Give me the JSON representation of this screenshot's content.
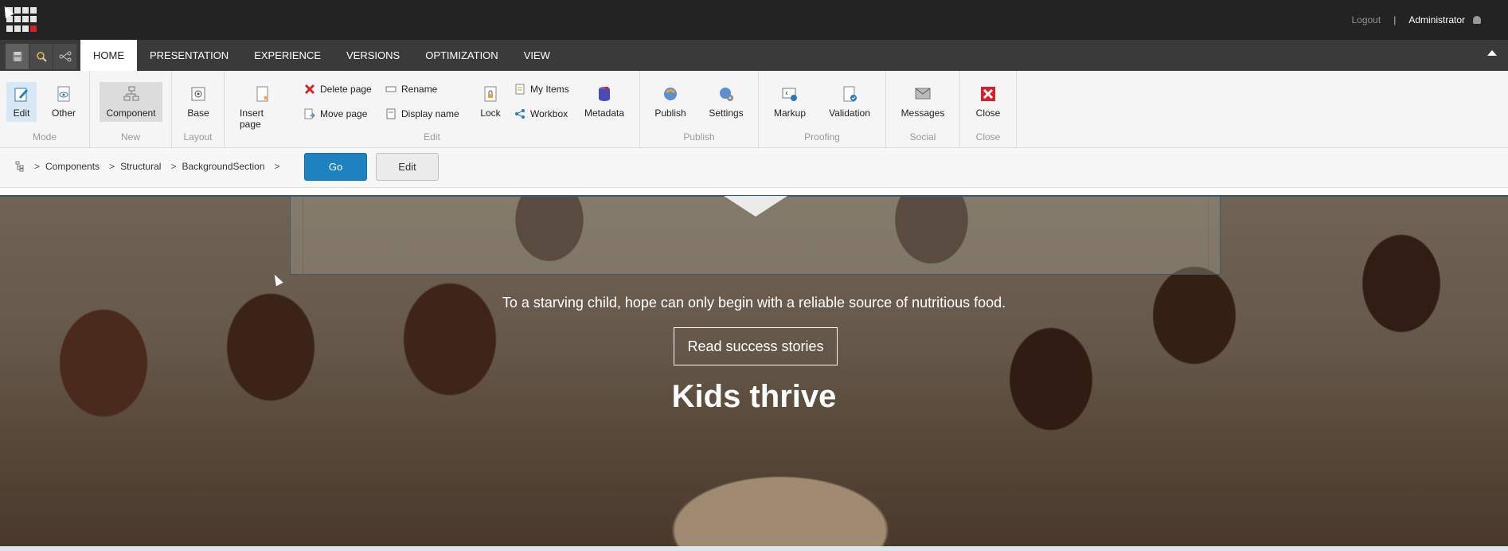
{
  "topbar": {
    "logout": "Logout",
    "separator": "|",
    "user": "Administrator"
  },
  "quick_access": [
    "save-icon",
    "search-icon",
    "navigate-icon"
  ],
  "tabs": [
    {
      "label": "HOME",
      "active": true
    },
    {
      "label": "PRESENTATION"
    },
    {
      "label": "EXPERIENCE"
    },
    {
      "label": "VERSIONS"
    },
    {
      "label": "OPTIMIZATION"
    },
    {
      "label": "VIEW"
    }
  ],
  "ribbon": {
    "mode": {
      "label": "Mode",
      "edit": "Edit",
      "other": "Other"
    },
    "new": {
      "label": "New",
      "component": "Component"
    },
    "layout": {
      "label": "Layout",
      "base": "Base"
    },
    "edit": {
      "label": "Edit",
      "insert_page": "Insert page",
      "delete_page": "Delete page",
      "move_page": "Move page",
      "rename": "Rename",
      "display_name": "Display name",
      "lock": "Lock",
      "my_items": "My Items",
      "workbox": "Workbox",
      "metadata": "Metadata"
    },
    "publish": {
      "label": "Publish",
      "publish": "Publish",
      "settings": "Settings"
    },
    "proofing": {
      "label": "Proofing",
      "markup": "Markup",
      "validation": "Validation"
    },
    "social": {
      "label": "Social",
      "messages": "Messages"
    },
    "close": {
      "label": "Close",
      "close": "Close"
    }
  },
  "breadcrumb": {
    "items": [
      "Components",
      "Structural",
      "BackgroundSection"
    ],
    "go": "Go",
    "edit": "Edit"
  },
  "hero": {
    "tagline": "To a starving child, hope can only begin with a reliable source of nutritious food.",
    "cta": "Read success stories",
    "headline": "Kids thrive"
  },
  "colors": {
    "topbar": "#232323",
    "tabbar": "#3a3a3a",
    "go_button": "#1f82c0",
    "delete_red": "#d2232a"
  }
}
